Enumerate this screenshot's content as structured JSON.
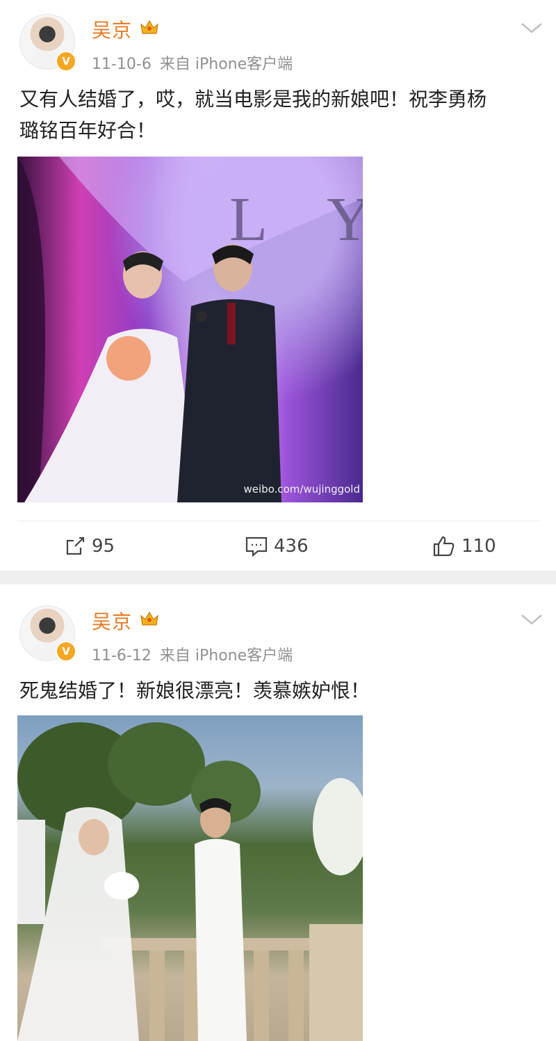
{
  "posts": [
    {
      "username": "吴京",
      "time": "11-10-6",
      "source": "来自 iPhone客户端",
      "text_line1": "又有人结婚了，哎，就当电影是我的新娘吧！祝李勇杨",
      "text_line2": "璐铭百年好合！",
      "photo_watermark": "weibo.com/wujinggold",
      "actions": {
        "repost_count": "95",
        "comment_count": "436",
        "like_count": "110"
      }
    },
    {
      "username": "吴京",
      "time": "11-6-12",
      "source": "来自 iPhone客户端",
      "text_line1": "死鬼结婚了！新娘很漂亮！羡慕嫉妒恨！"
    }
  ],
  "icons": {
    "verified": "verified-badge-icon",
    "crown": "crown-icon",
    "chevron": "chevron-down-icon",
    "repost": "repost-icon",
    "comment": "comment-icon",
    "like": "like-icon"
  },
  "colors": {
    "username": "#ea7a24",
    "verified": "#f5a623",
    "meta": "#909090",
    "separator": "#efefef"
  }
}
